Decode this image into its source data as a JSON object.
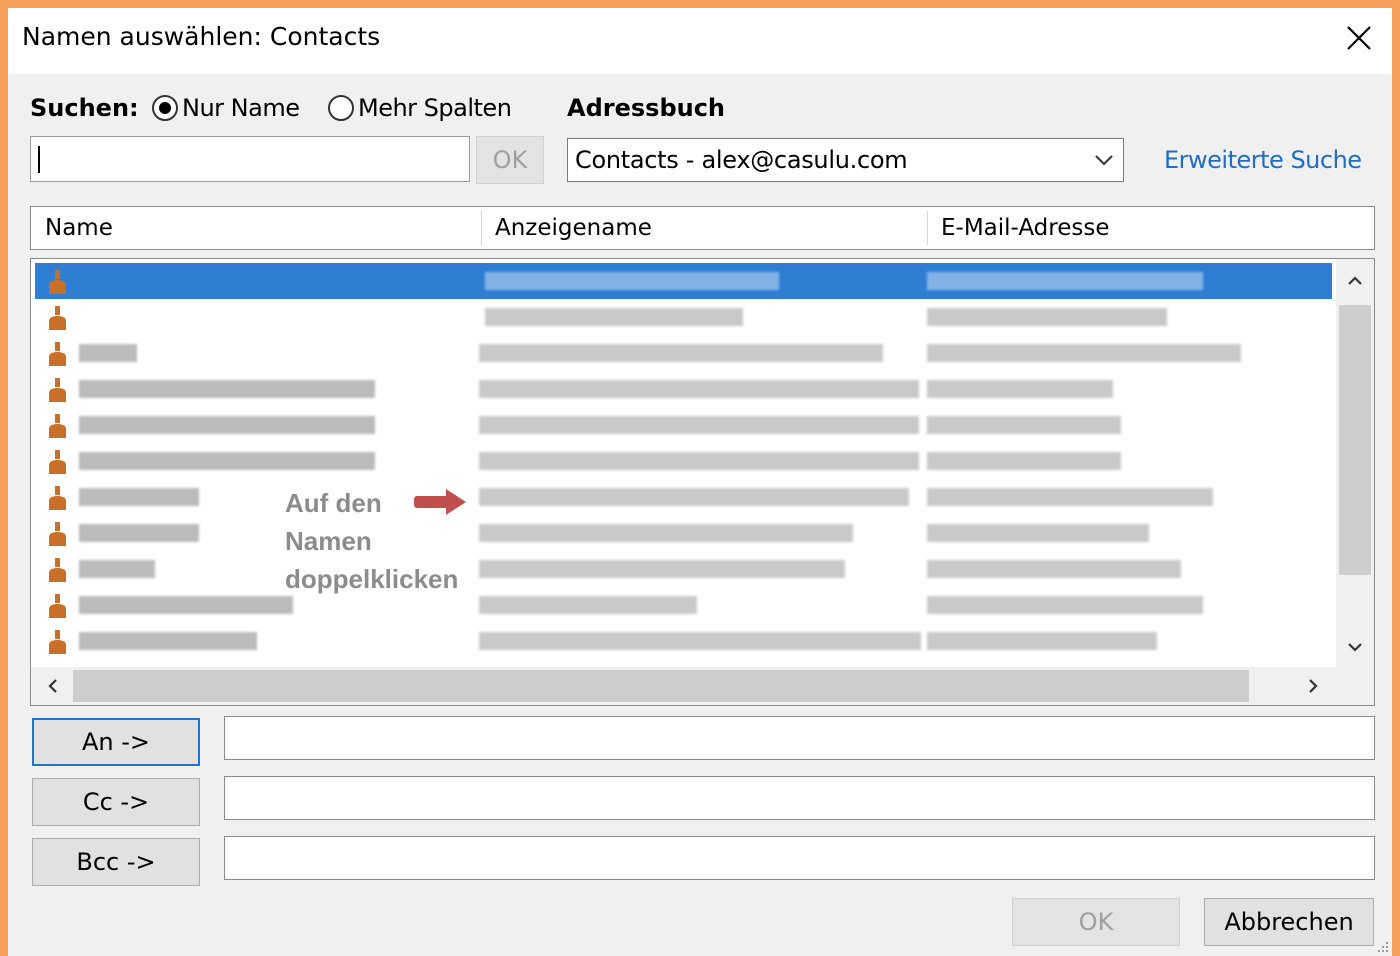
{
  "window": {
    "title": "Namen auswählen: Contacts"
  },
  "search": {
    "label": "Suchen:",
    "options": [
      {
        "label": "Nur Name",
        "checked": true
      },
      {
        "label": "Mehr Spalten",
        "checked": false
      }
    ],
    "input_value": "",
    "ok_label": "OK"
  },
  "addressbook": {
    "label": "Adressbuch",
    "selected": "Contacts - alex@casulu.com",
    "advanced_link": "Erweiterte Suche"
  },
  "table": {
    "columns": [
      "Name",
      "Anzeigename",
      "E-Mail-Adresse"
    ],
    "row_count": 11,
    "selected_row": 0,
    "note": ""
  },
  "annotation": {
    "lines": [
      "Auf den",
      "Namen",
      "doppelklicken"
    ],
    "color": "#8C8C8C",
    "arrow_color": "#C0504D"
  },
  "recipients": {
    "to_label": "An ->",
    "cc_label": "Cc ->",
    "bcc_label": "Bcc ->",
    "to_value": "",
    "cc_value": "",
    "bcc_value": ""
  },
  "footer": {
    "ok_label": "OK",
    "cancel_label": "Abbrechen"
  },
  "colors": {
    "frame": "#F5A05A",
    "selection": "#2E7ED4",
    "link": "#1E6EC8",
    "user_icon": "#C8702A"
  },
  "icons": [
    "close-icon",
    "chevron-down-icon",
    "user-icon",
    "arrow-right-icon",
    "resize-grip-icon"
  ]
}
